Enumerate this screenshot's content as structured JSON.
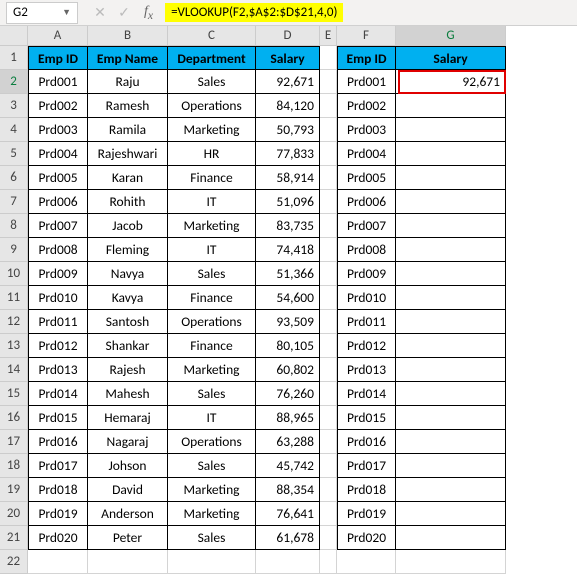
{
  "name_box": "G2",
  "formula": "=VLOOKUP(F2,$A$2:$D$21,4,0)",
  "columns": [
    "A",
    "B",
    "C",
    "D",
    "E",
    "F",
    "G"
  ],
  "headers_main": [
    "Emp ID",
    "Emp Name",
    "Department",
    "Salary"
  ],
  "headers_right": [
    "Emp ID",
    "Salary"
  ],
  "rows_main": [
    {
      "id": "Prd001",
      "name": "Raju",
      "dept": "Sales",
      "sal": "92,671"
    },
    {
      "id": "Prd002",
      "name": "Ramesh",
      "dept": "Operations",
      "sal": "84,120"
    },
    {
      "id": "Prd003",
      "name": "Ramila",
      "dept": "Marketing",
      "sal": "50,793"
    },
    {
      "id": "Prd004",
      "name": "Rajeshwari",
      "dept": "HR",
      "sal": "77,833"
    },
    {
      "id": "Prd005",
      "name": "Karan",
      "dept": "Finance",
      "sal": "58,914"
    },
    {
      "id": "Prd006",
      "name": "Rohith",
      "dept": "IT",
      "sal": "51,096"
    },
    {
      "id": "Prd007",
      "name": "Jacob",
      "dept": "Marketing",
      "sal": "83,735"
    },
    {
      "id": "Prd008",
      "name": "Fleming",
      "dept": "IT",
      "sal": "74,418"
    },
    {
      "id": "Prd009",
      "name": "Navya",
      "dept": "Sales",
      "sal": "51,366"
    },
    {
      "id": "Prd010",
      "name": "Kavya",
      "dept": "Finance",
      "sal": "54,600"
    },
    {
      "id": "Prd011",
      "name": "Santosh",
      "dept": "Operations",
      "sal": "93,509"
    },
    {
      "id": "Prd012",
      "name": "Shankar",
      "dept": "Finance",
      "sal": "80,105"
    },
    {
      "id": "Prd013",
      "name": "Rajesh",
      "dept": "Marketing",
      "sal": "60,802"
    },
    {
      "id": "Prd014",
      "name": "Mahesh",
      "dept": "Sales",
      "sal": "76,260"
    },
    {
      "id": "Prd015",
      "name": "Hemaraj",
      "dept": "IT",
      "sal": "88,965"
    },
    {
      "id": "Prd016",
      "name": "Nagaraj",
      "dept": "Operations",
      "sal": "63,288"
    },
    {
      "id": "Prd017",
      "name": "Johson",
      "dept": "Sales",
      "sal": "45,742"
    },
    {
      "id": "Prd018",
      "name": "David",
      "dept": "Marketing",
      "sal": "88,354"
    },
    {
      "id": "Prd019",
      "name": "Anderson",
      "dept": "Marketing",
      "sal": "76,641"
    },
    {
      "id": "Prd020",
      "name": "Peter",
      "dept": "Sales",
      "sal": "61,678"
    }
  ],
  "rows_right": [
    {
      "id": "Prd001",
      "sal": "92,671"
    },
    {
      "id": "Prd002",
      "sal": ""
    },
    {
      "id": "Prd003",
      "sal": ""
    },
    {
      "id": "Prd004",
      "sal": ""
    },
    {
      "id": "Prd005",
      "sal": ""
    },
    {
      "id": "Prd006",
      "sal": ""
    },
    {
      "id": "Prd007",
      "sal": ""
    },
    {
      "id": "Prd008",
      "sal": ""
    },
    {
      "id": "Prd009",
      "sal": ""
    },
    {
      "id": "Prd010",
      "sal": ""
    },
    {
      "id": "Prd011",
      "sal": ""
    },
    {
      "id": "Prd012",
      "sal": ""
    },
    {
      "id": "Prd013",
      "sal": ""
    },
    {
      "id": "Prd014",
      "sal": ""
    },
    {
      "id": "Prd015",
      "sal": ""
    },
    {
      "id": "Prd016",
      "sal": ""
    },
    {
      "id": "Prd017",
      "sal": ""
    },
    {
      "id": "Prd018",
      "sal": ""
    },
    {
      "id": "Prd019",
      "sal": ""
    },
    {
      "id": "Prd020",
      "sal": ""
    }
  ],
  "row_count": 22
}
